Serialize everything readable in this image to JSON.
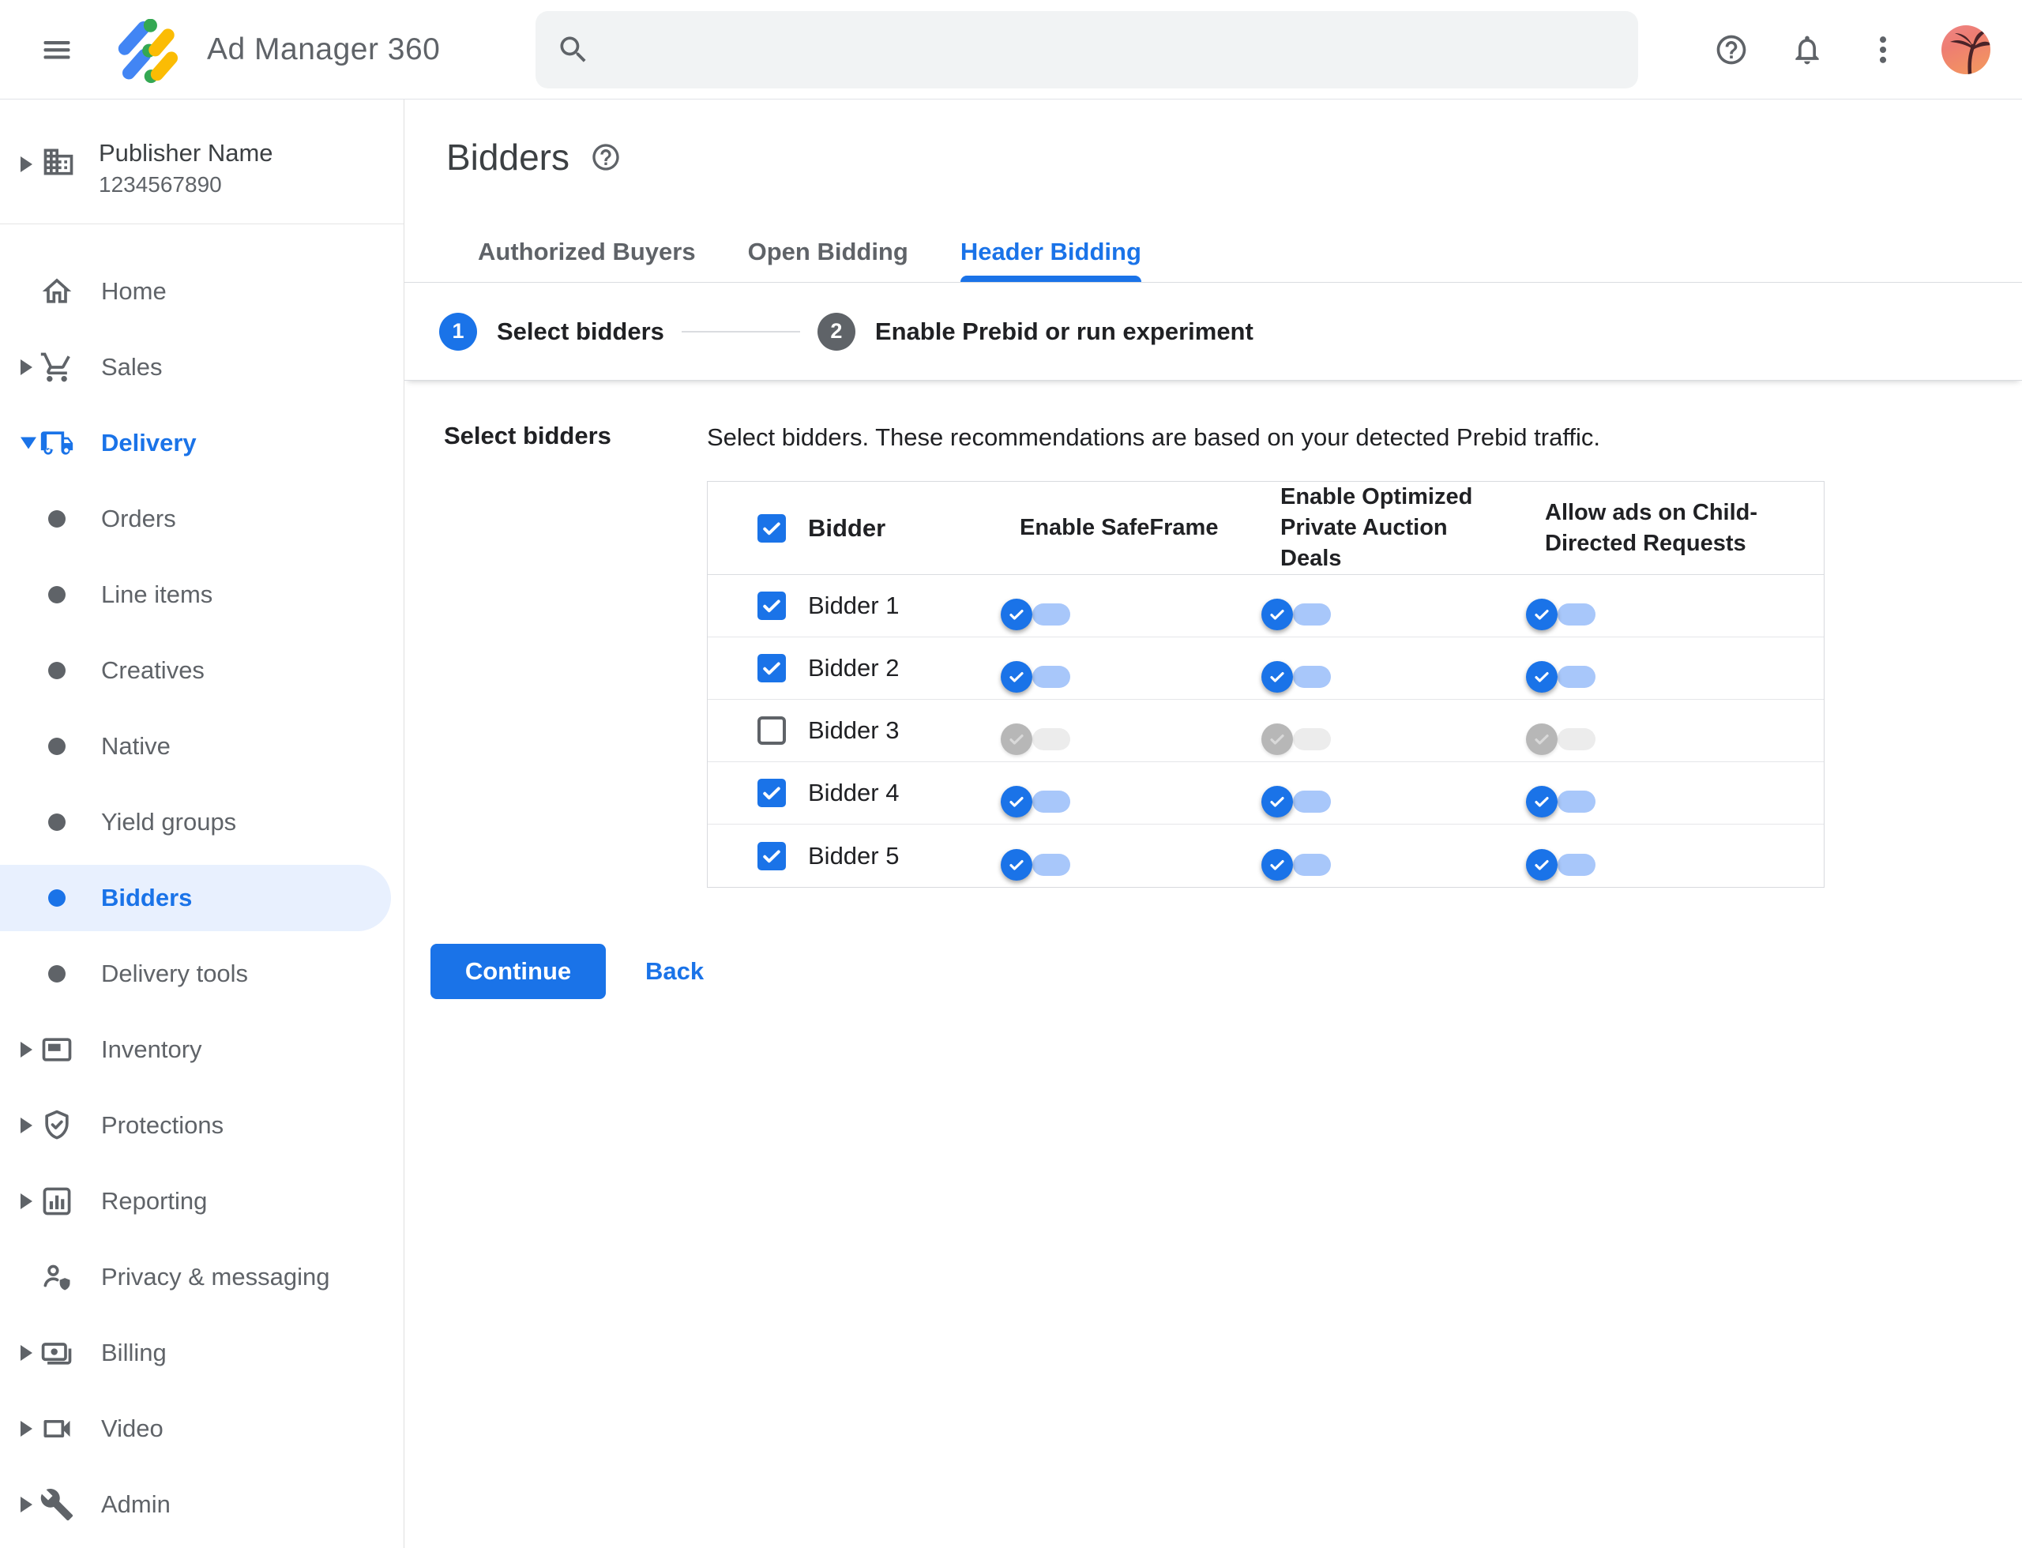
{
  "topbar": {
    "app_name": "Ad Manager 360",
    "search": {
      "placeholder": "",
      "value": ""
    },
    "icons": [
      "menu-icon",
      "ad-manager-logo",
      "search-icon",
      "help-icon",
      "notifications-icon",
      "more-vert-icon",
      "avatar-palm-tree"
    ]
  },
  "sidebar": {
    "publisher": {
      "name": "Publisher Name",
      "id": "1234567890",
      "icon": "building-icon",
      "arrow": "right"
    },
    "items": [
      {
        "label": "Home",
        "icon": "home-icon"
      },
      {
        "label": "Sales",
        "icon": "cart-icon",
        "arrow": "right"
      },
      {
        "label": "Delivery",
        "icon": "truck-icon",
        "arrow": "down",
        "expanded": true,
        "blue": true
      },
      {
        "label": "Orders",
        "bullet": true
      },
      {
        "label": "Line items",
        "bullet": true
      },
      {
        "label": "Creatives",
        "bullet": true
      },
      {
        "label": "Native",
        "bullet": true
      },
      {
        "label": "Yield groups",
        "bullet": true
      },
      {
        "label": "Bidders",
        "bullet": true,
        "selected": true
      },
      {
        "label": "Delivery tools",
        "bullet": true
      },
      {
        "label": "Inventory",
        "icon": "ad-unit-icon",
        "arrow": "right"
      },
      {
        "label": "Protections",
        "icon": "shield-check-icon",
        "arrow": "right"
      },
      {
        "label": "Reporting",
        "icon": "bar-chart-icon",
        "arrow": "right"
      },
      {
        "label": "Privacy & messaging",
        "icon": "person-shield-icon"
      },
      {
        "label": "Billing",
        "icon": "payments-icon",
        "arrow": "right"
      },
      {
        "label": "Video",
        "icon": "videocam-icon",
        "arrow": "right"
      },
      {
        "label": "Admin",
        "icon": "wrench-icon",
        "arrow": "right"
      }
    ]
  },
  "page": {
    "title": "Bidders",
    "title_help_icon": "help-icon",
    "tabs": [
      {
        "label": "Authorized Buyers",
        "active": false
      },
      {
        "label": "Open Bidding",
        "active": false
      },
      {
        "label": "Header Bidding",
        "active": true
      }
    ],
    "stepper": [
      {
        "number": "1",
        "label": "Select bidders",
        "state": "active"
      },
      {
        "number": "2",
        "label": "Enable Prebid or run experiment",
        "state": "inactive"
      }
    ],
    "section_label": "Select bidders",
    "description": "Select bidders. These recommendations are based on your detected Prebid traffic.",
    "table": {
      "select_all_checked": true,
      "columns": [
        "Bidder",
        "Enable SafeFrame",
        "Enable Optimized Private Auction Deals",
        "Allow ads on Child-Directed Requests"
      ],
      "rows": [
        {
          "name": "Bidder 1",
          "checked": true,
          "enable_safeframe": true,
          "enable_optimized_deals": true,
          "allow_child_directed": true,
          "toggles_disabled": false
        },
        {
          "name": "Bidder 2",
          "checked": true,
          "enable_safeframe": true,
          "enable_optimized_deals": true,
          "allow_child_directed": true,
          "toggles_disabled": false
        },
        {
          "name": "Bidder 3",
          "checked": false,
          "enable_safeframe": true,
          "enable_optimized_deals": true,
          "allow_child_directed": true,
          "toggles_disabled": true
        },
        {
          "name": "Bidder 4",
          "checked": true,
          "enable_safeframe": true,
          "enable_optimized_deals": true,
          "allow_child_directed": true,
          "toggles_disabled": false
        },
        {
          "name": "Bidder 5",
          "checked": true,
          "enable_safeframe": true,
          "enable_optimized_deals": true,
          "allow_child_directed": true,
          "toggles_disabled": false
        }
      ]
    },
    "actions": {
      "continue_label": "Continue",
      "back_label": "Back"
    }
  },
  "colors": {
    "accent_blue": "#1a73e8",
    "selected_item_bg": "#e8f0fe",
    "toggle_track_on": "#a8c7fa",
    "toggle_track_off": "#ececec",
    "toggle_thumb_off": "#b7b7b7",
    "table_border": "#dadce0",
    "logo_blue": "#4285f4",
    "logo_yellow": "#fbbc04",
    "logo_green": "#34a853"
  }
}
